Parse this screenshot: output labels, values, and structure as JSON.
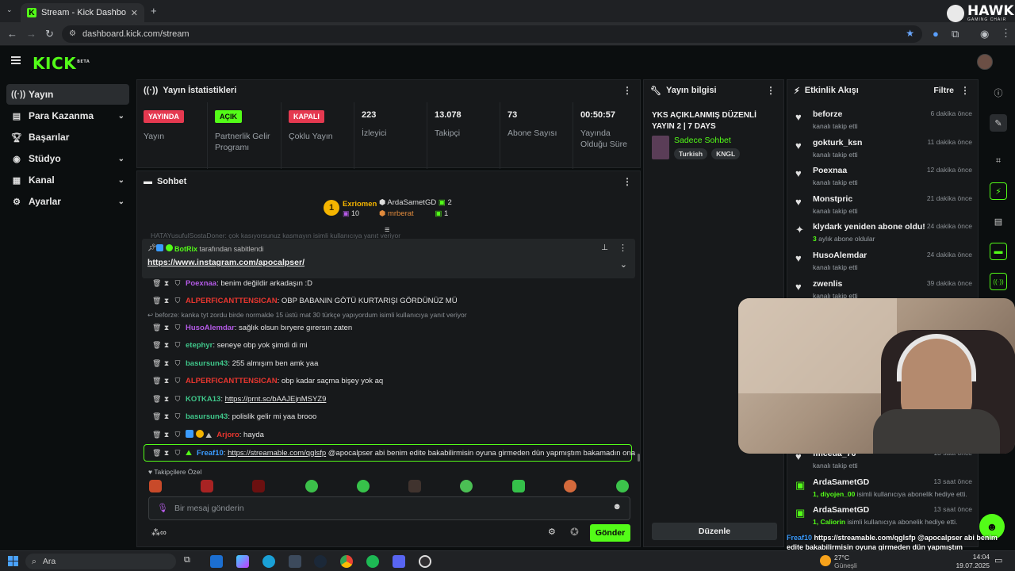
{
  "browser": {
    "tab_title": "Stream - Kick Dashboard",
    "url": "dashboard.kick.com/stream",
    "overlay_brand": "HAWK",
    "overlay_brand_sub": "GAMING CHAIR"
  },
  "app": {
    "logo": "KICK",
    "logo_badge": "BETA"
  },
  "sidebar": {
    "items": [
      {
        "label": "Yayın",
        "icon": "broadcast-icon"
      },
      {
        "label": "Para Kazanma",
        "icon": "money-icon"
      },
      {
        "label": "Başarılar",
        "icon": "trophy-icon"
      },
      {
        "label": "Stüdyo",
        "icon": "studio-icon"
      },
      {
        "label": "Kanal",
        "icon": "channel-icon"
      },
      {
        "label": "Ayarlar",
        "icon": "gear-icon"
      }
    ]
  },
  "stats": {
    "title": "Yayın İstatistikleri",
    "cells": [
      {
        "badge": "YAYINDA",
        "label": "Yayın"
      },
      {
        "badge": "AÇIK",
        "label": "Partnerlik Gelir Programı"
      },
      {
        "badge": "KAPALI",
        "label": "Çoklu Yayın"
      },
      {
        "value": "223",
        "label": "İzleyici"
      },
      {
        "value": "13.078",
        "label": "Takipçi"
      },
      {
        "value": "73",
        "label": "Abone Sayısı"
      },
      {
        "value": "00:50:57",
        "label": "Yayında Olduğu Süre"
      }
    ]
  },
  "stream_info": {
    "title_panel": "Yayın bilgisi",
    "stream_title": "YKS AÇIKLANMIŞ DÜZENLİ YAYIN 2 | 7 DAYS",
    "category": "Sadece Sohbet",
    "tags": [
      "Turkish",
      "KNGL"
    ],
    "edit_button": "Düzenle"
  },
  "chat": {
    "title": "Sohbet",
    "leaderboard": {
      "top_name": "Exriomen",
      "top_count": "10",
      "rank": "1",
      "others": [
        {
          "name": "ArdaSametGD",
          "count": "2"
        },
        {
          "name": "mrberat",
          "count": "1"
        }
      ]
    },
    "hidden_reply": "HATAYusufulSostaDoner: çok kasıyorsunuz kasmayın isimli kullanıcıya yanıt veriyor",
    "pinned": {
      "by_user": "BotRix",
      "by_suffix": "tarafından sabitlendi",
      "link": "https://www.instagram.com/apocalpser/"
    },
    "messages": [
      {
        "user": "Poexnaa",
        "color": "#b45ae6",
        "text": ": benim değildir arkadaşın :D"
      },
      {
        "user": "ALPERFICANTTENSICAN",
        "color": "#e8362f",
        "text": ": OBP BABANIN GÖTÜ KURTARIŞI GÖRDÜNÜZ MÜ"
      },
      {
        "reply": "beforze: kanka tyt zordu birde normalde 15 üstü mat 30 türkçe yapıyordum isimli kullanıcıya yanıt veriyor"
      },
      {
        "user": "HusoAlemdar",
        "color": "#b45ae6",
        "text": ": sağlık olsun bıryere gırersın zaten"
      },
      {
        "user": "etephyr",
        "color": "#3fc68a",
        "text": ": seneye obp yok şimdi di mi"
      },
      {
        "user": "basursun43",
        "color": "#3fc68a",
        "text": ": 255 almışım ben amk yaa"
      },
      {
        "user": "ALPERFICANTTENSICAN",
        "color": "#e8362f",
        "text": ": obp kadar saçma bişey yok aq"
      },
      {
        "user": "KOTKA13",
        "color": "#3fc68a",
        "text": ": ",
        "link": "https://prnt.sc/bAAJEjnMSYZ9"
      },
      {
        "user": "basursun43",
        "color": "#3fc68a",
        "text": ": polislik gelir mi yaa brooo"
      },
      {
        "user": "Arjoro",
        "color": "#e8362f",
        "text": ": hayda"
      },
      {
        "user": "Freaf10",
        "color": "#3b9cff",
        "text": ": ",
        "link": "https://streamable.com/qglsfp",
        "text_after": " @apocalpser abi benim edite bakabilirmisin oyuna girmeden dün yapmıştım bakamadın ona"
      }
    ],
    "emotes_label": "Takipçilere Özel",
    "input_placeholder": "Bir mesaj gönderin",
    "send_button": "Gönder"
  },
  "activity": {
    "title": "Etkinlik Akışı",
    "filter": "Filtre",
    "items": [
      {
        "name": "beforze",
        "sub": "kanalı takip etti",
        "time": "6 dakika önce"
      },
      {
        "name": "gokturk_ksn",
        "sub": "kanalı takip etti",
        "time": "11 dakika önce"
      },
      {
        "name": "Poexnaa",
        "sub": "kanalı takip etti",
        "time": "12 dakika önce"
      },
      {
        "name": "Monstpric",
        "sub": "kanalı takip etti",
        "time": "21 dakika önce"
      },
      {
        "name": "klydark yeniden abone oldu!",
        "sub_highlight": "3",
        "sub": " aylık abone oldular",
        "time": "24 dakika önce"
      },
      {
        "name": "HusoAlemdar",
        "sub": "kanalı takip etti",
        "time": "24 dakika önce"
      },
      {
        "name": "zwenlis",
        "sub": "kanalı takip etti",
        "time": "39 dakika önce"
      },
      {
        "name": "fmceda_76",
        "sub": "kanalı takip etti",
        "time": "13 saat önce"
      },
      {
        "name": "ArdaSametGD",
        "sub_highlight": "1, diyojen_00",
        "sub": " isimli kullanıcıya abonelik hediye etti.",
        "time": "13 saat önce"
      },
      {
        "name": "ArdaSametGD",
        "sub_highlight": "1, Caliorin",
        "sub": " isimli kullanıcıya abonelik hediye etti.",
        "time": "13 saat önce"
      }
    ]
  },
  "overlay_chat": {
    "user": "Freaf10",
    "text": "https://streamable.com/qglsfp @apocalpser abi benim edite bakabilirmisin oyuna girmeden dün yapmıştım bakamadın ona"
  },
  "taskbar": {
    "search": "Ara",
    "weather": "27°C",
    "weather_sub": "Güneşli",
    "time": "14:04",
    "date": "19.07.2025"
  },
  "colors": {
    "kick_green": "#53fc18",
    "live_red": "#e53950",
    "panel_bg": "#17191b"
  }
}
